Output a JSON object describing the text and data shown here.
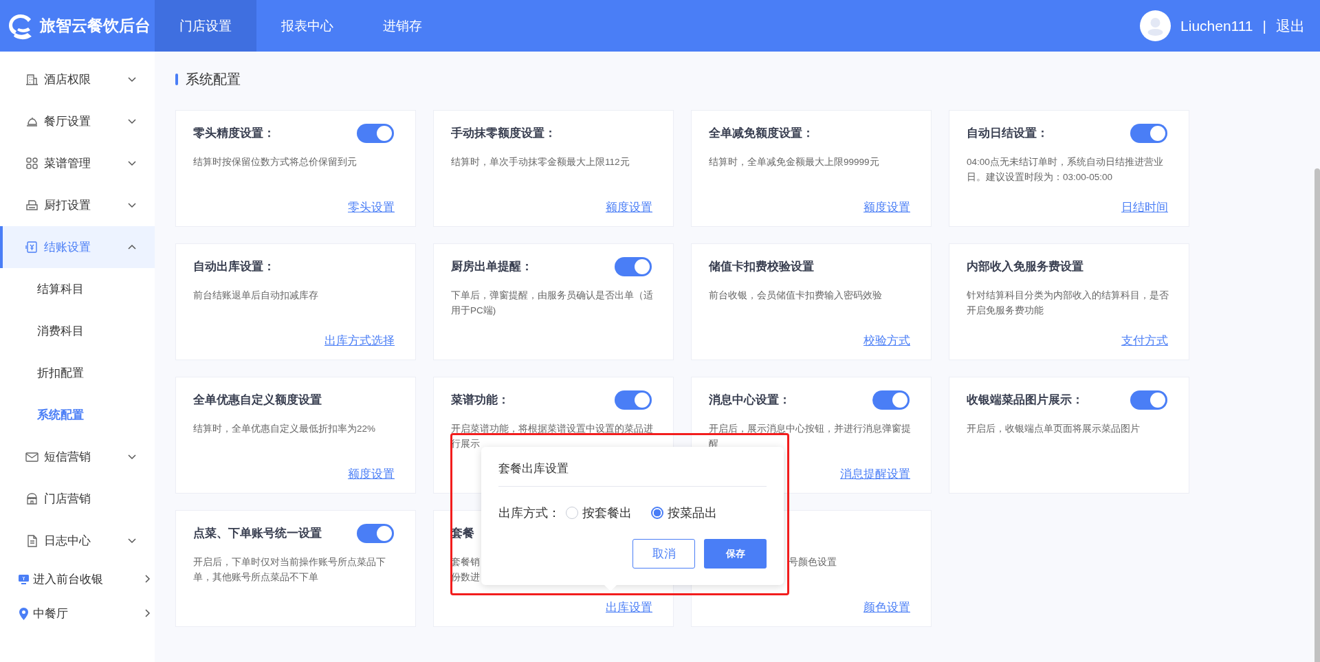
{
  "topbar": {
    "brand": "旅智云餐饮后台",
    "tabs": [
      {
        "label": "门店设置",
        "selected": true
      },
      {
        "label": "报表中心",
        "selected": false
      },
      {
        "label": "进销存",
        "selected": false
      }
    ],
    "user": "Liuchen111",
    "separator": "|",
    "logout": "退出"
  },
  "sidebar": {
    "items": [
      {
        "kind": "group",
        "label": "酒店权限",
        "selected": false,
        "expanded": false
      },
      {
        "kind": "group",
        "label": "餐厅设置",
        "selected": false,
        "expanded": false
      },
      {
        "kind": "group",
        "label": "菜谱管理",
        "selected": false,
        "expanded": false
      },
      {
        "kind": "group",
        "label": "厨打设置",
        "selected": false,
        "expanded": false
      },
      {
        "kind": "group",
        "label": "结账设置",
        "selected": true,
        "expanded": true,
        "children": [
          {
            "label": "结算科目",
            "selected": false
          },
          {
            "label": "消费科目",
            "selected": false
          },
          {
            "label": "折扣配置",
            "selected": false
          },
          {
            "label": "系统配置",
            "selected": true
          }
        ]
      },
      {
        "kind": "group",
        "label": "短信营销",
        "selected": false,
        "expanded": false
      },
      {
        "kind": "item",
        "label": "门店营销",
        "selected": false
      },
      {
        "kind": "group",
        "label": "日志中心",
        "selected": false,
        "expanded": false
      },
      {
        "kind": "link",
        "label": "进入前台收银"
      },
      {
        "kind": "link",
        "label": "中餐厅"
      }
    ]
  },
  "page": {
    "title": "系统配置",
    "cards": [
      {
        "title": "零头精度设置：",
        "switch": {
          "on": true
        },
        "description": "结算时按保留位数方式将总价保留到元",
        "link": "零头设置",
        "clipped_left": false
      },
      {
        "title": "手动抹零额度设置：",
        "description": "结算时，单次手动抹零金额最大上限112元",
        "link": "额度设置",
        "clipped_left": false
      },
      {
        "title": "全单减免额度设置：",
        "description": "结算时，全单减免金额最大上限99999元",
        "link": "额度设置",
        "clipped_left": false
      },
      {
        "title": "自动日结设置：",
        "switch": {
          "on": true
        },
        "description": "04:00点无未结订单时，系统自动日结推进营业日。建议设置时段为：03:00-05:00",
        "link": "日结时间",
        "clipped_left": false
      },
      {
        "title": "自动出库设置：",
        "description": "前台结账退单后自动扣减库存",
        "link": "出库方式选择",
        "clipped_left": false
      },
      {
        "title": "厨房出单提醒：",
        "switch": {
          "on": true
        },
        "description": "下单后，弹窗提醒，由服务员确认是否出单（适用于PC端)",
        "clipped_left": false
      },
      {
        "title": "储值卡扣费校验设置",
        "description": "前台收银，会员储值卡扣费输入密码效验",
        "link": "校验方式",
        "clipped_left": false
      },
      {
        "title": "内部收入免服务费设置",
        "description": "针对结算科目分类为内部收入的结算科目，是否开启免服务费功能",
        "link": "支付方式",
        "clipped_left": false
      },
      {
        "title": "全单优惠自定义额度设置",
        "description": "结算时，全单优惠自定义最低折扣率为22%",
        "link": "额度设置",
        "clipped_left": false
      },
      {
        "title": "菜谱功能：",
        "switch": {
          "on": true
        },
        "description": "开启菜谱功能，将根据菜谱设置中设置的菜品进行展示",
        "clipped_left": false
      },
      {
        "title": "消息中心设置：",
        "switch": {
          "on": true
        },
        "description": "开启后，展示消息中心按钮，并进行消息弹窗提醒",
        "link": "消息提醒设置",
        "clipped_left": false
      },
      {
        "title": "收银端菜品图片展示：",
        "switch": {
          "on": true
        },
        "description": "开启后，收银端点单页面将展示菜品图片",
        "clipped_left": false
      },
      {
        "title": "点菜、下单账号统一设置",
        "switch": {
          "on": true
        },
        "description": "开启后，下单时仅对当前操作账号所点菜品下单，其他账号所点菜品不下单",
        "clipped_left": false
      },
      {
        "title": "套餐",
        "description": [
          "套餐销",
          "份数进"
        ],
        "link": "出库设置",
        "clipped_left": false
      },
      {
        "description": "号颜色设置",
        "link": "颜色设置",
        "clipped_left": true
      }
    ],
    "popover": {
      "title": "套餐出库设置",
      "field_label": "出库方式：",
      "options": [
        {
          "label": "按套餐出",
          "selected": false
        },
        {
          "label": "按菜品出",
          "selected": true
        }
      ],
      "cancel": "取消",
      "save": "保存"
    }
  }
}
